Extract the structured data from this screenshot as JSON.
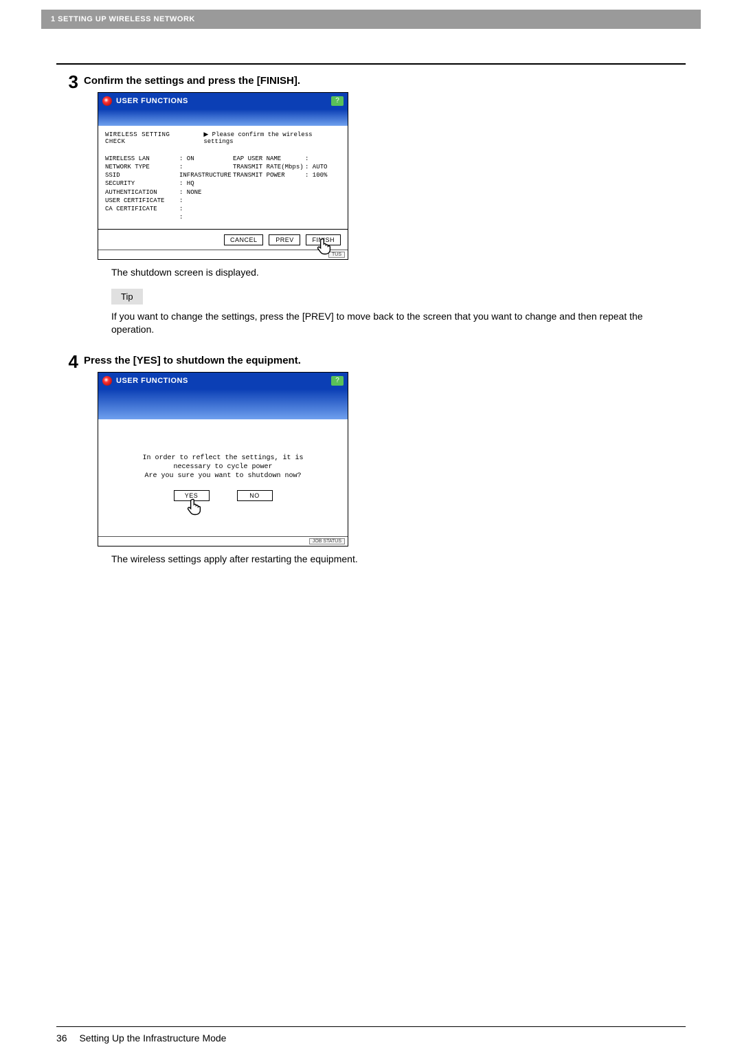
{
  "header": {
    "chapter": "1 SETTING UP WIRELESS NETWORK"
  },
  "step3": {
    "number": "3",
    "title": "Confirm the settings and press the [FINISH].",
    "panel_title": "USER FUNCTIONS",
    "help": "?",
    "check_title": "WIRELESS SETTING CHECK",
    "check_instr": "▶ Please confirm the wireless settings",
    "labels_left": [
      "WIRELESS LAN",
      "NETWORK TYPE",
      "SSID",
      "SECURITY",
      "AUTHENTICATION",
      "USER CERTIFICATE",
      "CA CERTIFICATE"
    ],
    "values_left": [
      ": ON",
      ": INFRASTRUCTURE",
      ": HQ",
      ": NONE",
      ":",
      ":",
      ":"
    ],
    "labels_right": [
      "EAP USER NAME",
      "TRANSMIT RATE(Mbps)",
      "TRANSMIT POWER"
    ],
    "values_right": [
      ":",
      ": AUTO",
      ": 100%"
    ],
    "btn_cancel": "CANCEL",
    "btn_prev": "PREV",
    "btn_finish": "FINISH",
    "job_status": "TUS",
    "caption": "The shutdown screen is displayed."
  },
  "tip": {
    "label": "Tip",
    "text": "If you want to change the settings, press the [PREV] to move back to the screen that you want to change and then repeat the operation."
  },
  "step4": {
    "number": "4",
    "title": "Press the [YES] to shutdown the equipment.",
    "panel_title": "USER FUNCTIONS",
    "help": "?",
    "msg_l1": "In order to reflect the settings, it is",
    "msg_l2": "necessary to cycle power",
    "msg_l3": "Are you sure you want to shutdown now?",
    "btn_yes": "YES",
    "btn_no": "NO",
    "job_status": "JOB STATUS",
    "caption": "The wireless settings apply after restarting the equipment."
  },
  "footer": {
    "page": "36",
    "section": "Setting Up the Infrastructure Mode"
  }
}
